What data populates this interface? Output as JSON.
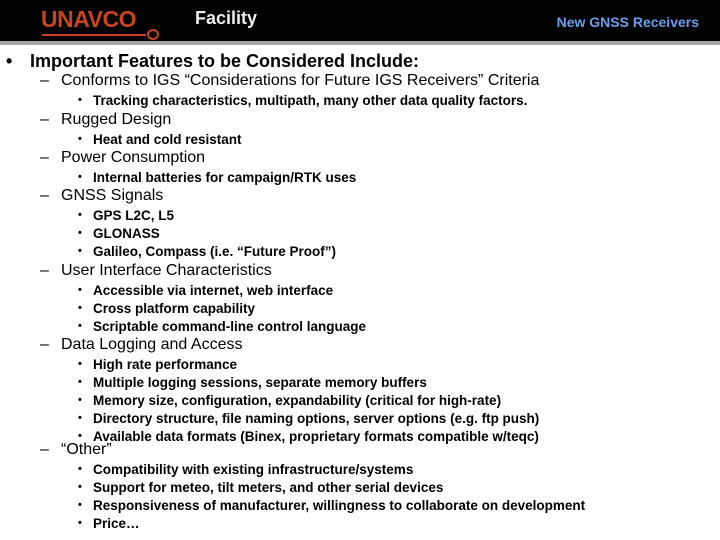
{
  "header": {
    "logo_text": "UNAVCO",
    "section": "Facility",
    "slide_title": "New GNSS Receivers",
    "colors": {
      "background": "#020202",
      "logo": "#c9441c",
      "title": "#6d9ee8",
      "rule": "#a6a6a6"
    }
  },
  "main": {
    "bullet_glyph": "•",
    "dash_glyph": "–",
    "heading": "Important Features to be Considered Include:",
    "sections": [
      {
        "title": "Conforms to IGS “Considerations for Future IGS Receivers” Criteria",
        "items": [
          "Tracking characteristics, multipath, many other data quality factors."
        ]
      },
      {
        "title": "Rugged Design",
        "items": [
          "Heat and cold resistant"
        ]
      },
      {
        "title": "Power Consumption",
        "items": [
          "Internal batteries for campaign/RTK uses"
        ]
      },
      {
        "title": "GNSS Signals",
        "items": [
          "GPS L2C, L5",
          "GLONASS",
          "Galileo, Compass (i.e. “Future Proof”)"
        ]
      },
      {
        "title": "User Interface Characteristics",
        "items": [
          "Accessible via internet, web interface",
          "Cross platform capability",
          "Scriptable command-line control language"
        ]
      },
      {
        "title": "Data Logging and Access",
        "items": [
          "High rate performance",
          "Multiple logging sessions, separate memory buffers",
          "Memory size, configuration, expandability (critical for high-rate)",
          "Directory structure, file naming options, server options (e.g. ftp push)",
          "Available data formats (Binex, proprietary formats compatible w/teqc)"
        ]
      },
      {
        "title": "“Other”",
        "items": [
          "Compatibility with existing infrastructure/systems",
          "Support for meteo, tilt meters, and other serial devices",
          "Responsiveness of manufacturer, willingness to collaborate on development",
          "Price…"
        ]
      }
    ]
  }
}
